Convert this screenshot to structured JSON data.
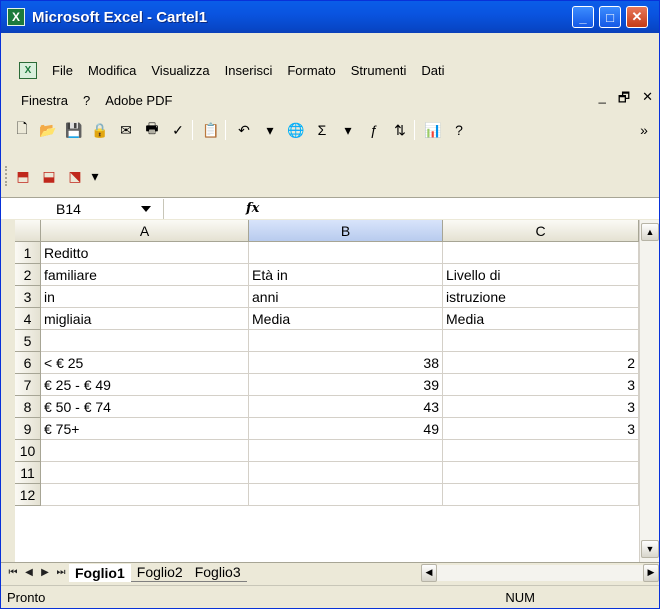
{
  "window": {
    "title": "Microsoft Excel - Cartel1",
    "app_icon": "excel-icon"
  },
  "menu": {
    "row1": [
      "File",
      "Modifica",
      "Visualizza",
      "Inserisci",
      "Formato",
      "Strumenti",
      "Dati"
    ],
    "row2": [
      "Finestra",
      "?",
      "Adobe PDF"
    ]
  },
  "formula_bar": {
    "name_box": "B14",
    "fx": "fx",
    "content": ""
  },
  "columns": [
    "A",
    "B",
    "C"
  ],
  "rows": [
    {
      "n": "1",
      "a": "Reditto",
      "b": "",
      "c": ""
    },
    {
      "n": "2",
      "a": "familiare",
      "b": "Età in",
      "c": "Livello di"
    },
    {
      "n": "3",
      "a": "in",
      "b": "anni",
      "c": "istruzione"
    },
    {
      "n": "4",
      "a": "migliaia",
      "b": "Media",
      "c": "Media"
    },
    {
      "n": "5",
      "a": "",
      "b": "",
      "c": ""
    },
    {
      "n": "6",
      "a": "< € 25",
      "b": "38",
      "c": "2"
    },
    {
      "n": "7",
      "a": "€ 25 - € 49",
      "b": "39",
      "c": "3"
    },
    {
      "n": "8",
      "a": "€ 50 - € 74",
      "b": "43",
      "c": "3"
    },
    {
      "n": "9",
      "a": "€ 75+",
      "b": "49",
      "c": "3"
    },
    {
      "n": "10",
      "a": "",
      "b": "",
      "c": ""
    },
    {
      "n": "11",
      "a": "",
      "b": "",
      "c": ""
    },
    {
      "n": "12",
      "a": "",
      "b": "",
      "c": ""
    }
  ],
  "sheets": [
    "Foglio1",
    "Foglio2",
    "Foglio3"
  ],
  "active_sheet": "Foglio1",
  "status": {
    "left": "Pronto",
    "num": "NUM"
  },
  "colors": {
    "titlebar": "#0a54e0",
    "selected_header": "#b8cbee",
    "chrome": "#ece9d8"
  }
}
